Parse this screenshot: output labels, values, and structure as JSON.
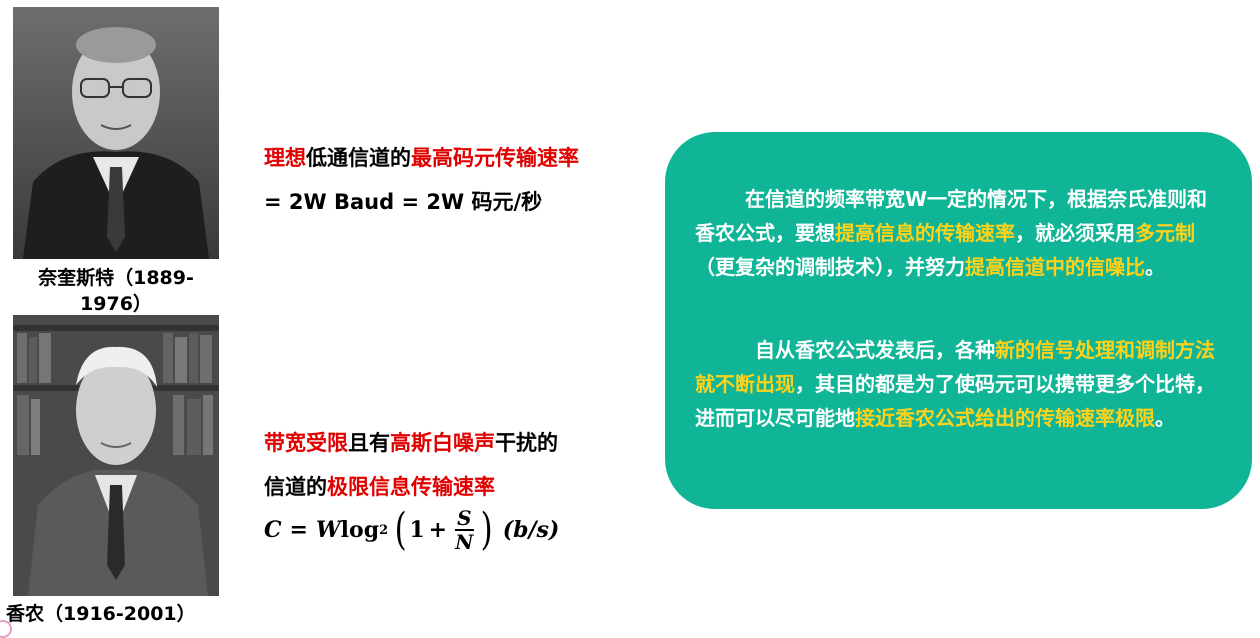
{
  "nyquist": {
    "caption": "奈奎斯特（1889-1976）",
    "line1": {
      "a": "理想",
      "b": "低通信道的",
      "c": "最高码元传输速率"
    },
    "line2": "= 2W Baud = 2W 码元/秒"
  },
  "shannon": {
    "caption": "香农（1916-2001）",
    "line1": {
      "a": "带宽受限",
      "b": "且有",
      "c": "高斯白噪声",
      "d": "干扰的"
    },
    "line2": {
      "a": "信道的",
      "b": "极限信息传输速率"
    },
    "formula": {
      "lhs": "C",
      "eq": "=",
      "w": "W",
      "log": "log",
      "base": "2",
      "lparen": "(",
      "one": "1",
      "plus": "+",
      "num": "S",
      "den": "N",
      "rparen": ")",
      "unit": "(b/s)"
    }
  },
  "note": {
    "p1": {
      "a": "在信道的频率带宽W一定的情况下，根据奈氏准则和香农公式，要想",
      "b": "提高信息的传输速率",
      "c": "，就必须采用",
      "d": "多元制",
      "e": "（更复杂的调制技术），并努力",
      "f": "提高信道中的信噪比",
      "g": "。"
    },
    "p2": {
      "a": "自从香农公式发表后，各种",
      "b": "新的信号处理和调制方法就不断出现",
      "c": "，其目的都是为了使码元可以携带更多个比特，进而可以尽可能地",
      "d": "接近香农公式给出的传输速率极限",
      "e": "。"
    }
  },
  "colors": {
    "red": "#e00000",
    "green_box": "#0fb596",
    "gold": "#ffd21a"
  }
}
